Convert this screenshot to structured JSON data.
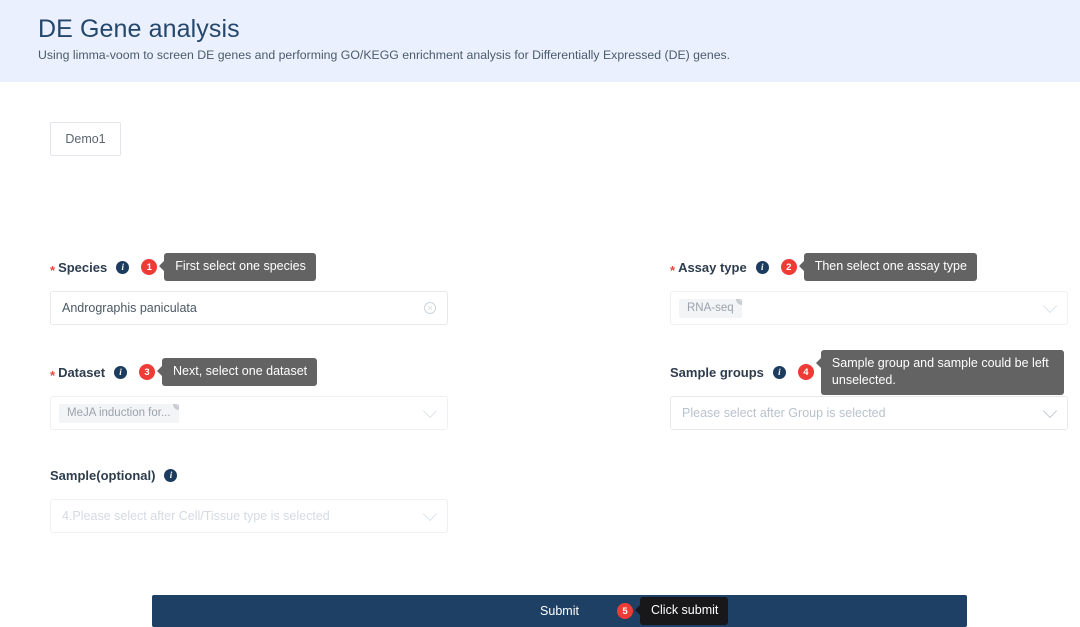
{
  "header": {
    "title": "DE Gene analysis",
    "subtitle": "Using limma-voom to screen DE genes and performing GO/KEGG enrichment analysis for Differentially Expressed (DE) genes.",
    "background_color": "#eaf0fd",
    "title_color": "#24476b"
  },
  "tabs": [
    {
      "label": "Demo1"
    }
  ],
  "icons": {
    "info": "i",
    "clear": "×",
    "chip_close": "×",
    "required_star": "*"
  },
  "colors": {
    "accent_badge": "#ef3b36",
    "tooltip_bg": "#636363",
    "tooltip_dark_bg": "#18181b",
    "submit_bg": "#1e4064",
    "info_icon_bg": "#1b3b5f"
  },
  "fields": {
    "species": {
      "label": "Species",
      "required": true,
      "step": "1",
      "tooltip": "First select one species",
      "value": "Andrographis paniculata",
      "has_clear": true
    },
    "assay_type": {
      "label": "Assay type",
      "required": true,
      "step": "2",
      "tooltip": "Then select one assay type",
      "chip": "RNA-seq"
    },
    "dataset": {
      "label": "Dataset",
      "required": true,
      "step": "3",
      "tooltip": "Next, select one dataset",
      "chip": "MeJA induction for..."
    },
    "sample_groups": {
      "label": "Sample groups",
      "required": false,
      "step": "4",
      "tooltip": "Sample group and sample could be left unselected.",
      "placeholder": "Please select after Group is selected"
    },
    "sample_optional": {
      "label": "Sample(optional)",
      "required": false,
      "placeholder": "4.Please select after Cell/Tissue type is selected"
    }
  },
  "submit": {
    "label": "Submit",
    "step": "5",
    "tooltip": "Click submit"
  }
}
